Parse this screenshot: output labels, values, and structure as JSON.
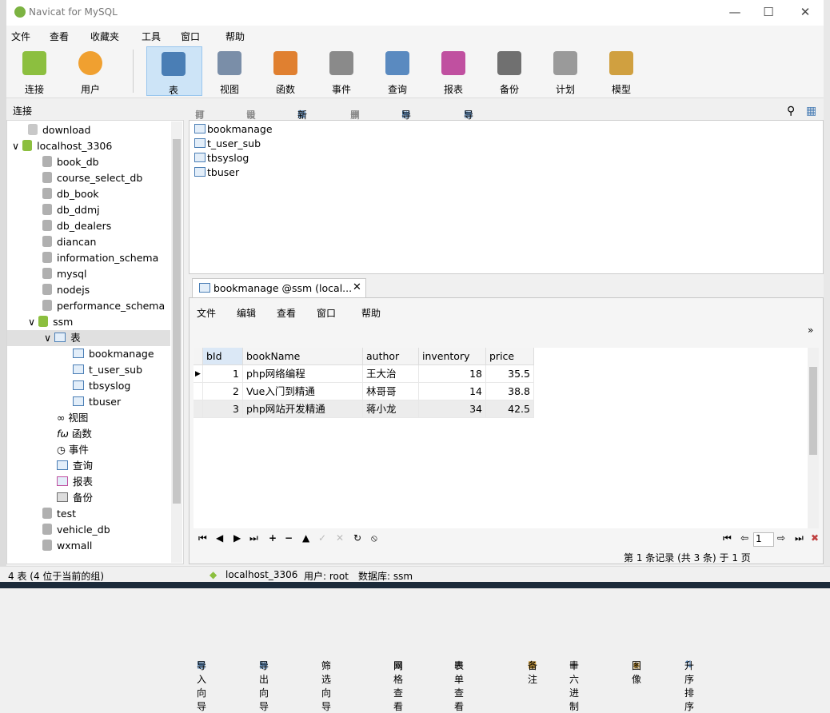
{
  "window": {
    "title": "Navicat for MySQL"
  },
  "menu": [
    "文件",
    "查看",
    "收藏夹",
    "工具",
    "窗口",
    "帮助"
  ],
  "toolbar": [
    {
      "label": "连接",
      "icon": "plug-icon",
      "color": "#8cbf3f"
    },
    {
      "label": "用户",
      "icon": "user-icon",
      "color": "#f0a030"
    },
    {
      "label": "表",
      "icon": "table-icon",
      "color": "#4a7eb5",
      "active": true
    },
    {
      "label": "视图",
      "icon": "view-icon",
      "color": "#7a8ea8"
    },
    {
      "label": "函数",
      "icon": "function-icon",
      "color": "#e08030"
    },
    {
      "label": "事件",
      "icon": "event-icon",
      "color": "#8a8a8a"
    },
    {
      "label": "查询",
      "icon": "query-icon",
      "color": "#5a8ac0"
    },
    {
      "label": "报表",
      "icon": "report-icon",
      "color": "#c050a0"
    },
    {
      "label": "备份",
      "icon": "backup-icon",
      "color": "#707070"
    },
    {
      "label": "计划",
      "icon": "schedule-icon",
      "color": "#9a9a9a"
    },
    {
      "label": "模型",
      "icon": "model-icon",
      "color": "#d0a040"
    }
  ],
  "sidebar": {
    "header": "连接",
    "tree": [
      {
        "label": "download",
        "level": 1,
        "type": "conn"
      },
      {
        "label": "localhost_3306",
        "level": 0,
        "type": "conn",
        "expanded": true
      },
      {
        "label": "book_db",
        "level": 2,
        "type": "db"
      },
      {
        "label": "course_select_db",
        "level": 2,
        "type": "db"
      },
      {
        "label": "db_book",
        "level": 2,
        "type": "db"
      },
      {
        "label": "db_ddmj",
        "level": 2,
        "type": "db"
      },
      {
        "label": "db_dealers",
        "level": 2,
        "type": "db"
      },
      {
        "label": "diancan",
        "level": 2,
        "type": "db"
      },
      {
        "label": "information_schema",
        "level": 2,
        "type": "db"
      },
      {
        "label": "mysql",
        "level": 2,
        "type": "db"
      },
      {
        "label": "nodejs",
        "level": 2,
        "type": "db"
      },
      {
        "label": "performance_schema",
        "level": 2,
        "type": "db"
      },
      {
        "label": "ssm",
        "level": 1,
        "type": "db-open",
        "expanded": true
      },
      {
        "label": "表",
        "level": 2,
        "type": "tables",
        "expanded": true,
        "selected": true
      },
      {
        "label": "bookmanage",
        "level": 4,
        "type": "table"
      },
      {
        "label": "t_user_sub",
        "level": 4,
        "type": "table"
      },
      {
        "label": "tbsyslog",
        "level": 4,
        "type": "table"
      },
      {
        "label": "tbuser",
        "level": 4,
        "type": "table"
      },
      {
        "label": "视图",
        "level": 3,
        "type": "view"
      },
      {
        "label": "函数",
        "level": 3,
        "type": "func"
      },
      {
        "label": "事件",
        "level": 3,
        "type": "event"
      },
      {
        "label": "查询",
        "level": 3,
        "type": "query"
      },
      {
        "label": "报表",
        "level": 3,
        "type": "report"
      },
      {
        "label": "备份",
        "level": 3,
        "type": "backup"
      },
      {
        "label": "test",
        "level": 2,
        "type": "db"
      },
      {
        "label": "vehicle_db",
        "level": 2,
        "type": "db"
      },
      {
        "label": "wxmall",
        "level": 2,
        "type": "db"
      }
    ]
  },
  "object_toolbar": [
    "打开表",
    "设计表",
    "新建表",
    "删除表",
    "导入向导",
    "导出向导"
  ],
  "object_list": [
    "bookmanage",
    "t_user_sub",
    "tbsyslog",
    "tbuser"
  ],
  "editor": {
    "tab_label": "bookmanage @ssm (local...",
    "menu": [
      "文件",
      "编辑",
      "查看",
      "窗口",
      "帮助"
    ],
    "toolbar": [
      "导入向导",
      "导出向导",
      "筛选向导",
      "网格查看",
      "表单查看",
      "备注",
      "十六进制",
      "图像",
      "升序排序"
    ],
    "columns": [
      "bId",
      "bookName",
      "author",
      "inventory",
      "price"
    ],
    "rows": [
      [
        "1",
        "php网络编程",
        "王大治",
        "18",
        "35.5"
      ],
      [
        "2",
        "Vue入门到精通",
        "林哥哥",
        "14",
        "38.8"
      ],
      [
        "3",
        "php网站开发精通",
        "蒋小龙",
        "34",
        "42.5"
      ]
    ],
    "page_value": "1",
    "record_status": "第 1 条记录 (共 3 条) 于 1 页"
  },
  "statusbar": {
    "left": "4 表 (4 位于当前的组)",
    "connection": "localhost_3306",
    "user": "用户: root",
    "database": "数据库: ssm"
  }
}
